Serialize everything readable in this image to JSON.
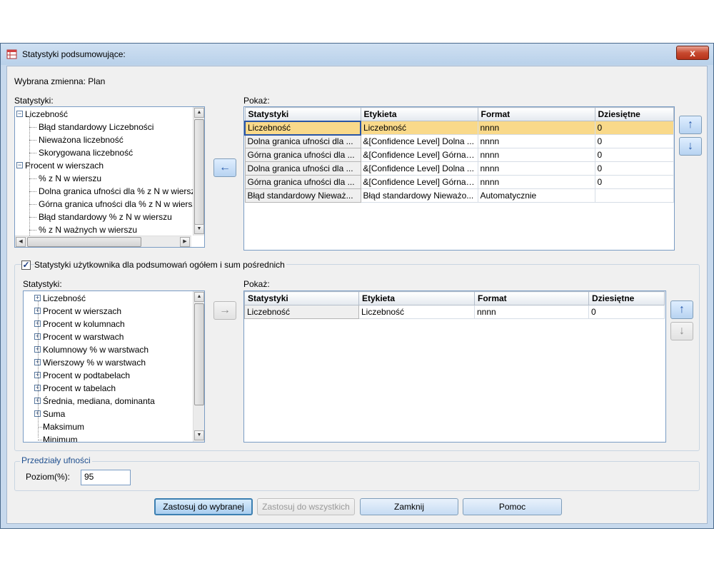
{
  "window": {
    "title": "Statystyki  podsumowujące:",
    "close_label": "x"
  },
  "variable_label": "Wybrana zmienna: Plan",
  "top": {
    "stats_label": "Statystyki:",
    "tree": [
      {
        "label": "Liczebność",
        "level": 0,
        "expander": "-"
      },
      {
        "label": "Błąd standardowy Liczebności",
        "level": 1
      },
      {
        "label": "Nieważona liczebność",
        "level": 1
      },
      {
        "label": "Skorygowana liczebność",
        "level": 1
      },
      {
        "label": "Procent w wierszach",
        "level": 0,
        "expander": "-"
      },
      {
        "label": "% z N w wierszu",
        "level": 1
      },
      {
        "label": "Dolna granica ufności dla % z N w wierszu",
        "level": 1
      },
      {
        "label": "Górna granica ufności dla % z N w wierszu",
        "level": 1
      },
      {
        "label": "Błąd standardowy % z N w wierszu",
        "level": 1
      },
      {
        "label": "% z N ważnych w wierszu",
        "level": 1
      }
    ],
    "move_arrow": "←",
    "show_label": "Pokaż:",
    "columns": [
      "Statystyki",
      "Etykieta",
      "Format",
      "Dziesiętne"
    ],
    "rows": [
      [
        "Liczebność",
        "Liczebność",
        "nnnn",
        "0"
      ],
      [
        "Dolna granica ufności dla ...",
        "&[Confidence Level] Dolna ...",
        "nnnn",
        "0"
      ],
      [
        "Górna granica ufności dla ...",
        "&[Confidence Level] Górna ...",
        "nnnn",
        "0"
      ],
      [
        "Dolna granica ufności dla ...",
        "&[Confidence Level] Dolna ...",
        "nnnn",
        "0"
      ],
      [
        "Górna granica ufności dla ...",
        "&[Confidence Level] Górna ...",
        "nnnn",
        "0"
      ],
      [
        "Błąd standardowy Nieważ...",
        "Błąd standardowy Nieważo...",
        "Automatycznie",
        ""
      ]
    ],
    "up_arrow": "↑",
    "down_arrow": "↓"
  },
  "bottom": {
    "checkbox_label": "Statystyki użytkownika dla podsumowań ogółem i sum pośrednich",
    "checkbox_checked": true,
    "stats_label": "Statystyki:",
    "tree": [
      {
        "label": "Liczebność",
        "expander": "+"
      },
      {
        "label": "Procent w wierszach",
        "expander": "+"
      },
      {
        "label": "Procent w kolumnach",
        "expander": "+"
      },
      {
        "label": "Procent w warstwach",
        "expander": "+"
      },
      {
        "label": "Kolumnowy % w warstwach",
        "expander": "+"
      },
      {
        "label": "Wierszowy % w warstwach",
        "expander": "+"
      },
      {
        "label": "Procent w podtabelach",
        "expander": "+"
      },
      {
        "label": "Procent w tabelach",
        "expander": "+"
      },
      {
        "label": "Średnia, mediana, dominanta",
        "expander": "+"
      },
      {
        "label": "Suma",
        "expander": "+"
      },
      {
        "label": "Maksimum",
        "expander": ""
      },
      {
        "label": "Minimum",
        "expander": ""
      }
    ],
    "move_arrow": "→",
    "show_label": "Pokaż:",
    "columns": [
      "Statystyki",
      "Etykieta",
      "Format",
      "Dziesiętne"
    ],
    "rows": [
      [
        "Liczebność",
        "Liczebność",
        "nnnn",
        "0"
      ]
    ],
    "up_arrow": "↑",
    "down_arrow": "↓"
  },
  "confidence": {
    "group_label": "Przedziały ufności",
    "level_label": "Poziom(%):",
    "level_value": "95"
  },
  "buttons": {
    "apply_selected": "Zastosuj do wybranej",
    "apply_all": "Zastosuj do wszystkich",
    "close": "Zamknij",
    "help": "Pomoc"
  }
}
